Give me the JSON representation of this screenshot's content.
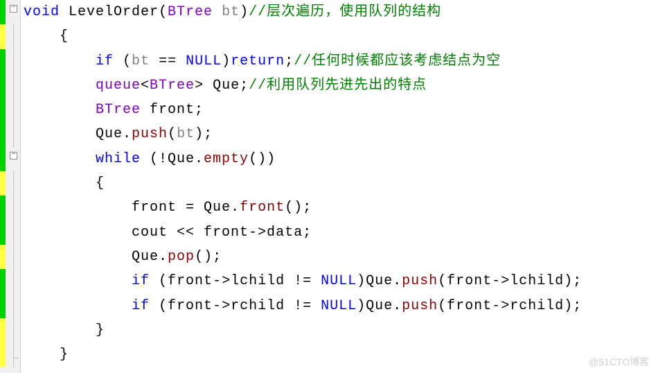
{
  "code": {
    "lines": [
      {
        "marker": "green",
        "fold": "minus",
        "tokens": [
          {
            "cls": "kw",
            "t": "void"
          },
          {
            "cls": "txt",
            "t": " LevelOrder("
          },
          {
            "cls": "type",
            "t": "BTree"
          },
          {
            "cls": "txt",
            "t": " "
          },
          {
            "cls": "param",
            "t": "bt"
          },
          {
            "cls": "txt",
            "t": ")"
          },
          {
            "cls": "comment",
            "t": "//层次遍历，使用队列的结构"
          }
        ]
      },
      {
        "marker": "yellow",
        "indent": 1,
        "tokens": [
          {
            "cls": "txt",
            "t": "{"
          }
        ]
      },
      {
        "marker": "green",
        "indent": 2,
        "tokens": [
          {
            "cls": "kw",
            "t": "if"
          },
          {
            "cls": "txt",
            "t": " ("
          },
          {
            "cls": "param",
            "t": "bt"
          },
          {
            "cls": "txt",
            "t": " == "
          },
          {
            "cls": "null",
            "t": "NULL"
          },
          {
            "cls": "txt",
            "t": ")"
          },
          {
            "cls": "kw",
            "t": "return"
          },
          {
            "cls": "txt",
            "t": ";"
          },
          {
            "cls": "comment",
            "t": "//任何时候都应该考虑结点为空"
          }
        ]
      },
      {
        "marker": "green",
        "indent": 2,
        "tokens": [
          {
            "cls": "type",
            "t": "queue"
          },
          {
            "cls": "txt",
            "t": "<"
          },
          {
            "cls": "type",
            "t": "BTree"
          },
          {
            "cls": "txt",
            "t": "> Que;"
          },
          {
            "cls": "comment",
            "t": "//利用队列先进先出的特点"
          }
        ]
      },
      {
        "marker": "green",
        "indent": 2,
        "tokens": [
          {
            "cls": "type",
            "t": "BTree"
          },
          {
            "cls": "txt",
            "t": " front;"
          }
        ]
      },
      {
        "marker": "green",
        "indent": 2,
        "tokens": [
          {
            "cls": "txt",
            "t": "Que."
          },
          {
            "cls": "method",
            "t": "push"
          },
          {
            "cls": "txt",
            "t": "("
          },
          {
            "cls": "param",
            "t": "bt"
          },
          {
            "cls": "txt",
            "t": ");"
          }
        ]
      },
      {
        "marker": "green",
        "fold": "minus",
        "indent": 2,
        "tokens": [
          {
            "cls": "kw",
            "t": "while"
          },
          {
            "cls": "txt",
            "t": " (!Que."
          },
          {
            "cls": "method",
            "t": "empty"
          },
          {
            "cls": "txt",
            "t": "())"
          }
        ]
      },
      {
        "marker": "yellow",
        "indent": 2,
        "tokens": [
          {
            "cls": "txt",
            "t": "{"
          }
        ]
      },
      {
        "marker": "green",
        "indent": 3,
        "tokens": [
          {
            "cls": "txt",
            "t": "front = Que."
          },
          {
            "cls": "method",
            "t": "front"
          },
          {
            "cls": "txt",
            "t": "();"
          }
        ]
      },
      {
        "marker": "green",
        "indent": 3,
        "tokens": [
          {
            "cls": "txt",
            "t": "cout << front->data;"
          }
        ]
      },
      {
        "marker": "yellow",
        "indent": 3,
        "tokens": [
          {
            "cls": "txt",
            "t": "Que."
          },
          {
            "cls": "method",
            "t": "pop"
          },
          {
            "cls": "txt",
            "t": "();"
          }
        ]
      },
      {
        "marker": "green",
        "indent": 3,
        "tokens": [
          {
            "cls": "kw",
            "t": "if"
          },
          {
            "cls": "txt",
            "t": " (front->lchild != "
          },
          {
            "cls": "null",
            "t": "NULL"
          },
          {
            "cls": "txt",
            "t": ")Que."
          },
          {
            "cls": "method",
            "t": "push"
          },
          {
            "cls": "txt",
            "t": "(front->lchild);"
          }
        ]
      },
      {
        "marker": "green",
        "indent": 3,
        "tokens": [
          {
            "cls": "kw",
            "t": "if"
          },
          {
            "cls": "txt",
            "t": " (front->rchild != "
          },
          {
            "cls": "null",
            "t": "NULL"
          },
          {
            "cls": "txt",
            "t": ")Que."
          },
          {
            "cls": "method",
            "t": "push"
          },
          {
            "cls": "txt",
            "t": "(front->rchild);"
          }
        ]
      },
      {
        "marker": "yellow",
        "indent": 2,
        "tokens": [
          {
            "cls": "txt",
            "t": "}"
          }
        ]
      },
      {
        "marker": "yellow",
        "foldEnd": true,
        "indent": 1,
        "tokens": [
          {
            "cls": "txt",
            "t": "}"
          }
        ]
      }
    ]
  },
  "foldGlyph": "−",
  "watermark": "@51CTO博客"
}
